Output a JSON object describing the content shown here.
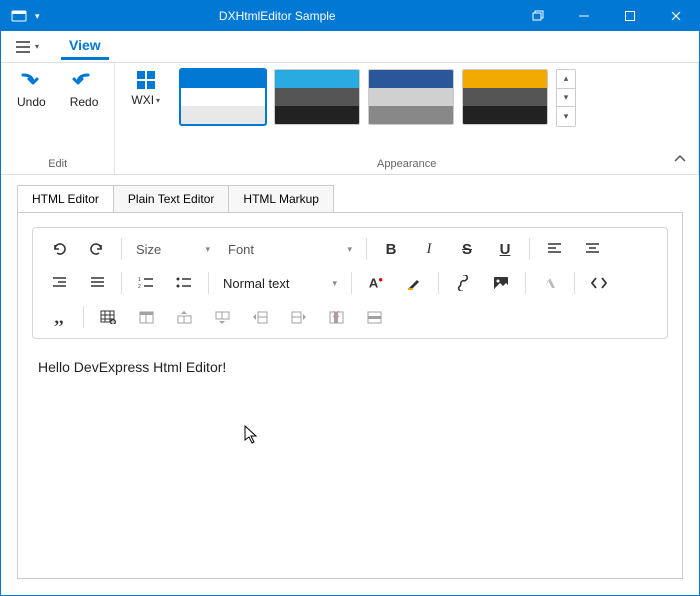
{
  "window": {
    "title": "DXHtmlEditor Sample"
  },
  "ribbon": {
    "tab_view": "View",
    "edit": {
      "undo": "Undo",
      "redo": "Redo",
      "group_label": "Edit"
    },
    "appearance": {
      "skin_label": "WXI",
      "group_label": "Appearance"
    }
  },
  "tabs": [
    "HTML Editor",
    "Plain Text Editor",
    "HTML Markup"
  ],
  "toolbar": {
    "size": "Size",
    "font": "Font",
    "paragraph": "Normal text"
  },
  "content": {
    "text": "Hello DevExpress Html Editor!"
  }
}
